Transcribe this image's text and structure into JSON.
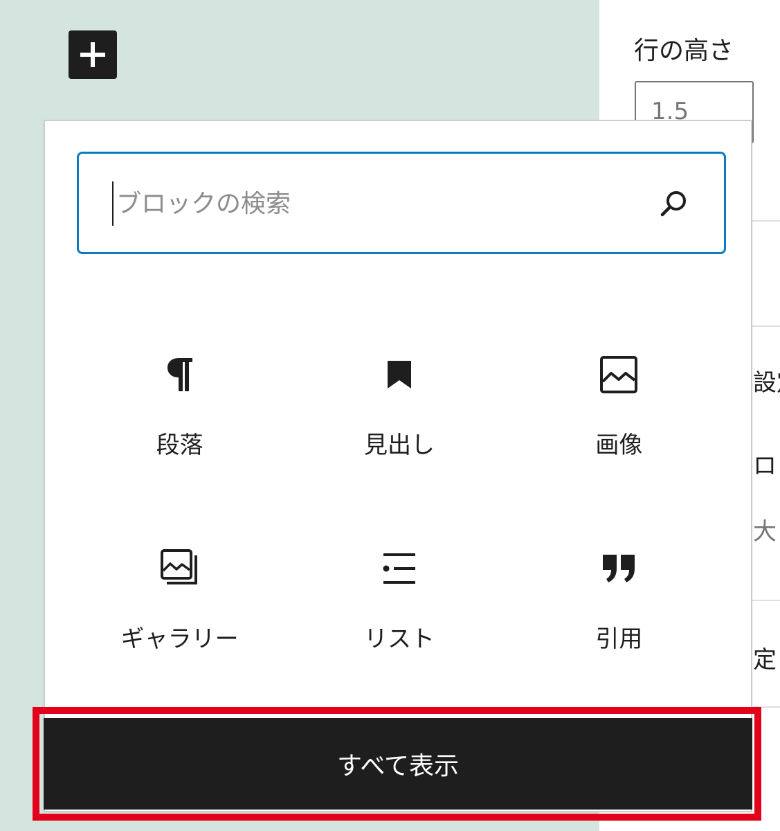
{
  "sidebar": {
    "line_height_label": "行の高さ",
    "line_height_value": "1.5",
    "peek_settings": "設定",
    "peek_ro": "ロ",
    "peek_dai": "大",
    "peek_tei": "定"
  },
  "inserter": {
    "search_placeholder": "ブロックの検索",
    "blocks": [
      {
        "label": "段落",
        "icon": "paragraph-icon"
      },
      {
        "label": "見出し",
        "icon": "heading-bookmark-icon"
      },
      {
        "label": "画像",
        "icon": "image-icon"
      },
      {
        "label": "ギャラリー",
        "icon": "gallery-icon"
      },
      {
        "label": "リスト",
        "icon": "list-icon"
      },
      {
        "label": "引用",
        "icon": "quote-icon"
      }
    ],
    "show_all_label": "すべて表示"
  },
  "colors": {
    "canvas_bg": "#d3e5de",
    "focus_blue": "#0a7cbf",
    "dark": "#1e1e1e",
    "highlight_red": "#e2001a"
  }
}
